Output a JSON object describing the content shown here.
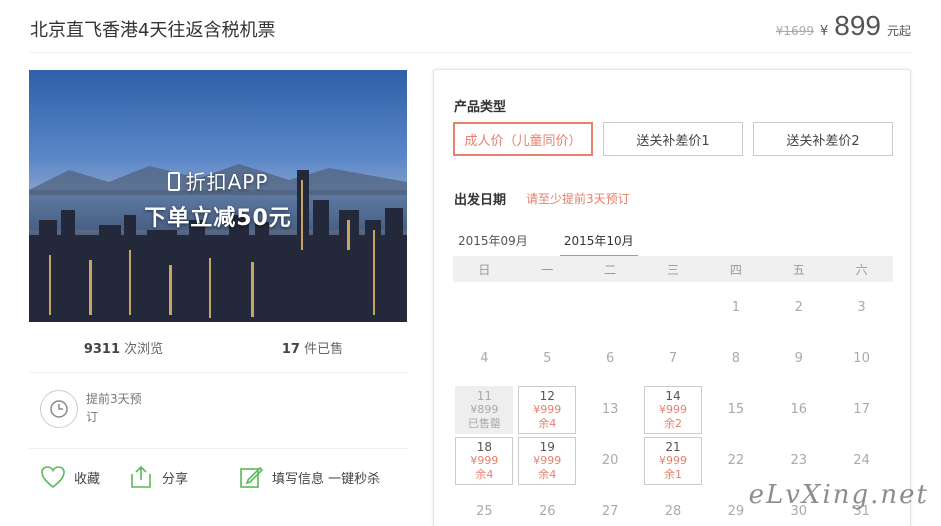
{
  "product": {
    "title": "北京直飞香港4天往返含税机票",
    "old_price": "¥1699",
    "currency": "¥",
    "price": "899",
    "price_suffix": "元起"
  },
  "banner": {
    "line1": "折扣APP",
    "line2": "下单立减50元"
  },
  "stats": {
    "views_num": "9311",
    "views_label": " 次浏览",
    "sold_num": "17",
    "sold_label": " 件已售"
  },
  "advance": {
    "text": "提前3天预订"
  },
  "actions": {
    "favorite": "收藏",
    "share": "分享",
    "fill_info": "填写信息 一键秒杀"
  },
  "panel": {
    "type_label": "产品类型",
    "types": [
      "成人价（儿童同价）",
      "送关补差价1",
      "送关补差价2"
    ],
    "active_type": 0,
    "date_label": "出发日期",
    "date_hint": "请至少提前3天预订",
    "months": [
      "2015年09月",
      "2015年10月"
    ],
    "active_month": 1,
    "weekdays": [
      "日",
      "一",
      "二",
      "三",
      "四",
      "五",
      "六"
    ],
    "days": [
      {
        "d": ""
      },
      {
        "d": ""
      },
      {
        "d": ""
      },
      {
        "d": ""
      },
      {
        "d": "1"
      },
      {
        "d": "2"
      },
      {
        "d": "3"
      },
      {
        "d": "4"
      },
      {
        "d": "5"
      },
      {
        "d": "6"
      },
      {
        "d": "7"
      },
      {
        "d": "8"
      },
      {
        "d": "9"
      },
      {
        "d": "10"
      },
      {
        "d": "11",
        "price": "¥899",
        "note": "已售罄",
        "state": "sold"
      },
      {
        "d": "12",
        "price": "¥999",
        "note": "余4",
        "state": "avail"
      },
      {
        "d": "13"
      },
      {
        "d": "14",
        "price": "¥999",
        "note": "余2",
        "state": "avail"
      },
      {
        "d": "15"
      },
      {
        "d": "16"
      },
      {
        "d": "17"
      },
      {
        "d": "18",
        "price": "¥999",
        "note": "余4",
        "state": "avail"
      },
      {
        "d": "19",
        "price": "¥999",
        "note": "余4",
        "state": "avail"
      },
      {
        "d": "20"
      },
      {
        "d": "21",
        "price": "¥999",
        "note": "余1",
        "state": "avail"
      },
      {
        "d": "22"
      },
      {
        "d": "23"
      },
      {
        "d": "24"
      },
      {
        "d": "25"
      },
      {
        "d": "26"
      },
      {
        "d": "27"
      },
      {
        "d": "28"
      },
      {
        "d": "29"
      },
      {
        "d": "30"
      },
      {
        "d": "31"
      }
    ]
  },
  "watermark": "eLvXing.net",
  "colors": {
    "accent": "#e8806e",
    "border": "#cccccc",
    "muted": "#aaaaaa"
  }
}
